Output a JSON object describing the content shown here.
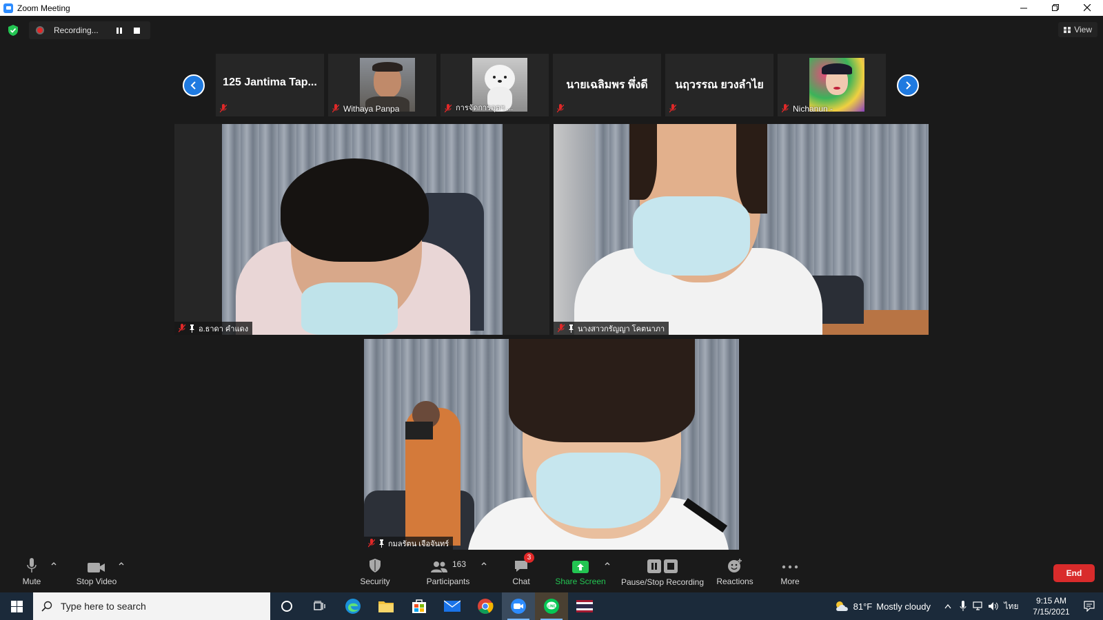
{
  "window": {
    "title": "Zoom Meeting"
  },
  "recording": {
    "label": "Recording..."
  },
  "view_label": "View",
  "thumbnails": [
    {
      "name": "125 Jantima Tap..."
    },
    {
      "name": "Withaya Panpa"
    },
    {
      "name": "การจัดการอุตฯ ..."
    },
    {
      "name": "นายเฉลิมพร พึ่งดี"
    },
    {
      "name": "นฤวรรณ ยวงลำไย"
    },
    {
      "name": "Nichanun -"
    }
  ],
  "tiles": [
    {
      "name": "อ.ธาดา คำแดง"
    },
    {
      "name": "นางสาวกรัญญา โคตนาภา"
    },
    {
      "name": "กมลรัตน เจือจันทร์"
    }
  ],
  "toolbar": {
    "mute": "Mute",
    "stop_video": "Stop Video",
    "security": "Security",
    "participants": "Participants",
    "participants_count": "163",
    "chat": "Chat",
    "chat_badge": "3",
    "share_screen": "Share Screen",
    "pause_stop_recording": "Pause/Stop Recording",
    "reactions": "Reactions",
    "more": "More",
    "end": "End"
  },
  "taskbar": {
    "search_placeholder": "Type here to search",
    "weather_temp": "81°F",
    "weather_desc": "Mostly cloudy",
    "input_lang": "ไทย",
    "time": "9:15 AM",
    "date": "7/15/2021"
  },
  "colors": {
    "accent_blue": "#2d8cff",
    "end_red": "#d92b2b",
    "share_green": "#23c552",
    "muted_red": "#e02828"
  }
}
